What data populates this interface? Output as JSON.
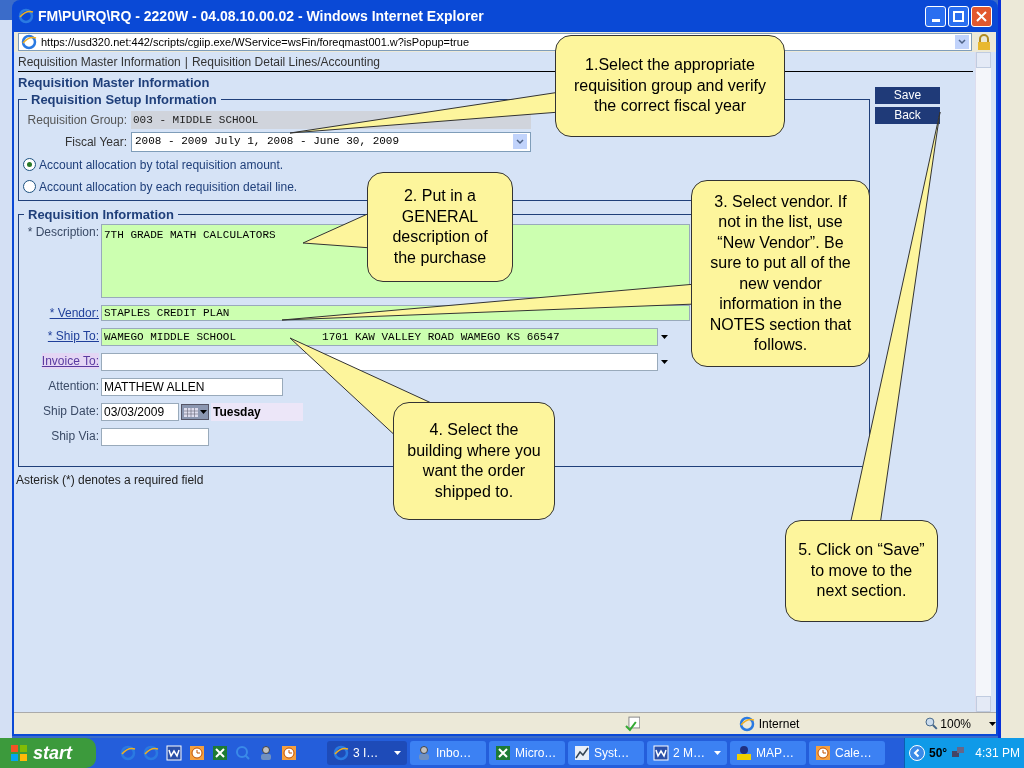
{
  "window": {
    "title": "FM\\PU\\RQ\\RQ - 2220W - 04.08.10.00.02 - Windows Internet Explorer",
    "address": "https://usd320.net:442/scripts/cgiip.exe/WService=wsFin/foreqmast001.w?isPopup=true"
  },
  "page_tabs": [
    {
      "label": "Requisition Master Information"
    },
    {
      "label": "Requisition Detail Lines/Accounting"
    }
  ],
  "tab_separator": "|",
  "heading": "Requisition Master Information",
  "setup": {
    "legend": "Requisition Setup Information",
    "group_label": "Requisition Group:",
    "group_value": "003 - MIDDLE SCHOOL",
    "fiscal_label": "Fiscal Year:",
    "fiscal_value": "2008 - 2009 July 1, 2008 - June 30, 2009",
    "radios": [
      {
        "label": "Account allocation by total requisition amount.",
        "selected": true
      },
      {
        "label": "Account allocation by each requisition detail line.",
        "selected": false
      }
    ]
  },
  "actions": [
    "Save",
    "Back"
  ],
  "requisition": {
    "legend": "Requisition Information",
    "fields": [
      {
        "kind": "textarea",
        "label": "* Description:",
        "is_link": false,
        "visited": false,
        "highlighted": true,
        "value": "7TH GRADE MATH CALCULATORS"
      },
      {
        "kind": "lookup",
        "label": "* Vendor:",
        "is_link": true,
        "visited": false,
        "highlighted": true,
        "value": "STAPLES CREDIT PLAN"
      },
      {
        "kind": "select",
        "label": "* Ship To:",
        "is_link": true,
        "visited": false,
        "highlighted": true,
        "value": "WAMEGO MIDDLE SCHOOL",
        "address": "1701 KAW VALLEY ROAD WAMEGO KS 66547"
      },
      {
        "kind": "select",
        "label": "Invoice To:",
        "is_link": true,
        "visited": true,
        "highlighted": false
      },
      {
        "kind": "text",
        "label": "Attention:",
        "is_link": false,
        "visited": false,
        "highlighted": false,
        "value": "MATTHEW ALLEN"
      },
      {
        "kind": "date",
        "label": "Ship Date:",
        "is_link": false,
        "visited": false,
        "highlighted": false,
        "value": "03/03/2009",
        "day": "Tuesday"
      },
      {
        "kind": "text",
        "label": "Ship Via:",
        "is_link": false,
        "visited": false,
        "highlighted": false
      }
    ]
  },
  "footnote": "Asterisk (*) denotes a required field",
  "callouts": [
    {
      "text": "1.Select the appropriate requisition group and verify the correct fiscal year"
    },
    {
      "text": "2. Put in a GENERAL description of the purchase"
    },
    {
      "text": "3. Select vendor. If not in the list, use “New Vendor”. Be sure to put all of the new vendor information in the NOTES section that follows."
    },
    {
      "text": "4. Select the building where you want the order shipped to."
    },
    {
      "text": "5. Click on “Save” to move to the next section."
    }
  ],
  "status_bar": {
    "zone": "Internet",
    "zoom": "100%"
  },
  "taskbar": {
    "start": "start",
    "tasks": [
      {
        "label": "3 I…",
        "kind": "browser",
        "selected": true,
        "has_menu": true
      },
      {
        "label": "Inbo…",
        "kind": "mail",
        "selected": false,
        "has_menu": false
      },
      {
        "label": "Micro…",
        "kind": "spreadsheet",
        "selected": false,
        "has_menu": false
      },
      {
        "label": "Syst…",
        "kind": "system",
        "selected": false,
        "has_menu": false
      },
      {
        "label": "2 M…",
        "kind": "document",
        "selected": false,
        "has_menu": true
      },
      {
        "label": "MAP…",
        "kind": "money",
        "selected": false,
        "has_menu": false
      },
      {
        "label": "Cale…",
        "kind": "calendar",
        "selected": false,
        "has_menu": false
      }
    ],
    "tray": {
      "temperature": "50°",
      "time": "4:31 PM"
    }
  }
}
